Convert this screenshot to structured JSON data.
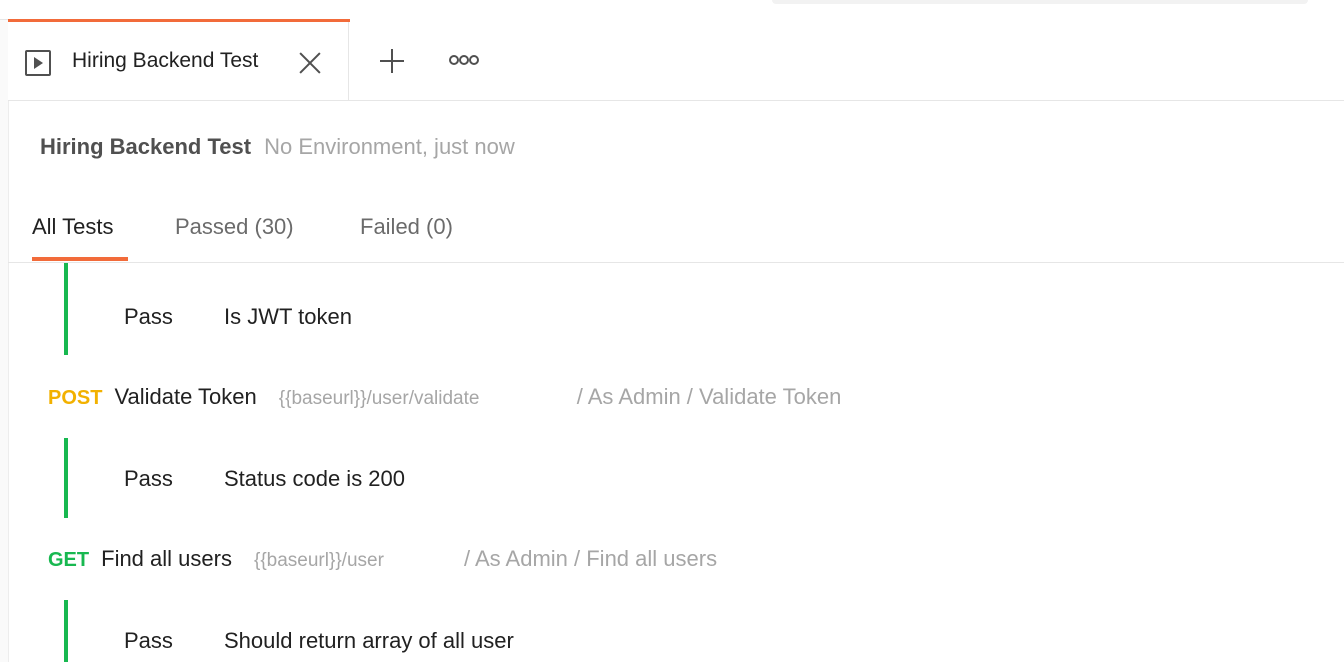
{
  "tab": {
    "title": "Hiring Backend Test",
    "icon": "runner-play-icon",
    "accent_color": "#f26b3a"
  },
  "run": {
    "name": "Hiring Backend Test",
    "meta": "No Environment, just now"
  },
  "filters": {
    "all": "All Tests",
    "passed": "Passed (30)",
    "failed": "Failed (0)"
  },
  "colors": {
    "post": "#f2b100",
    "get": "#18b850",
    "pass_bar": "#18b850"
  },
  "results": [
    {
      "status": "Pass",
      "name": "Is JWT token"
    },
    {
      "status": "Pass",
      "name": "Status code is 200"
    },
    {
      "status": "Pass",
      "name": "Should return array of all user"
    }
  ],
  "requests": [
    {
      "method": "POST",
      "name": "Validate Token",
      "url": "{{baseurl}}/user/validate",
      "path": "/ As Admin / Validate Token"
    },
    {
      "method": "GET",
      "name": "Find all users",
      "url": "{{baseurl}}/user",
      "path": "/ As Admin / Find all users"
    }
  ]
}
